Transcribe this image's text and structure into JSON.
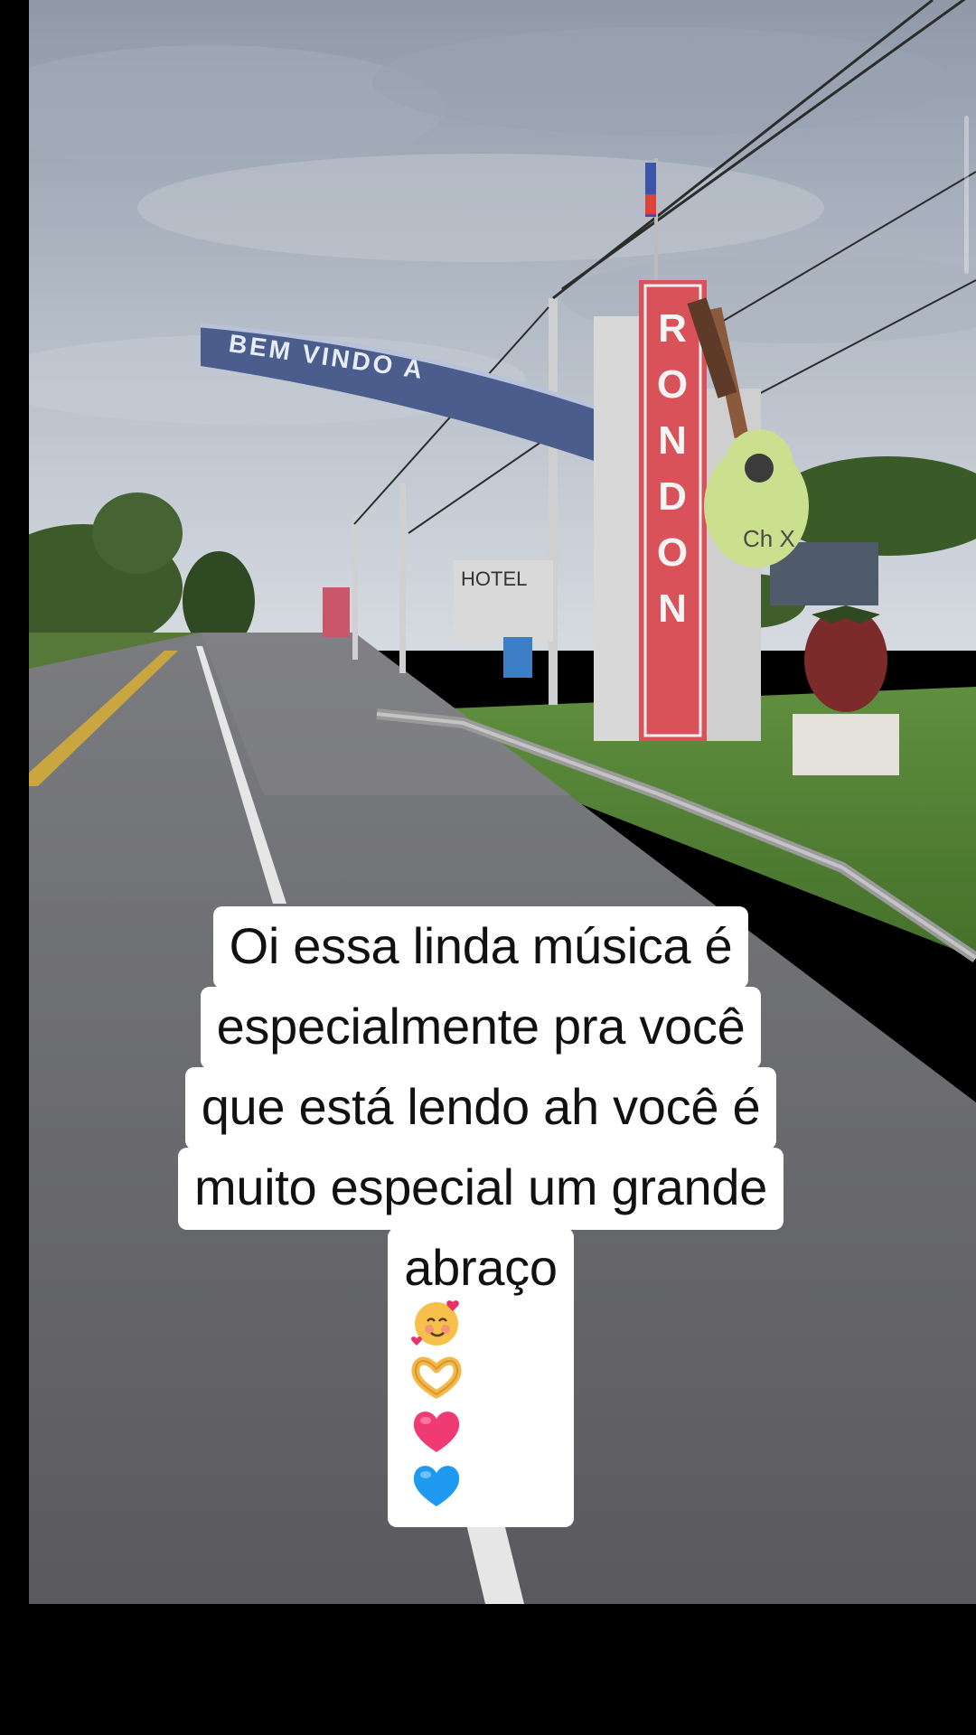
{
  "video": {
    "scene": {
      "arch_text": "BEM VINDO A",
      "tower_text": "RONDON",
      "guitar_text": "Ch X",
      "hotel_text": "HOTEL"
    }
  },
  "caption": {
    "line1": "Oi essa linda música é",
    "line2": "especialmente pra você",
    "line3": "que está lendo ah você é",
    "line4": "muito especial um grande",
    "line5": "abraço",
    "emojis": [
      "smiling-face-with-hearts",
      "heart-hands",
      "pink-heart",
      "blue-heart"
    ]
  },
  "colors": {
    "caption_bg": "#ffffff",
    "caption_text": "#111111",
    "tower_red": "#d9525a",
    "arch_blue": "#4a5d8c"
  }
}
